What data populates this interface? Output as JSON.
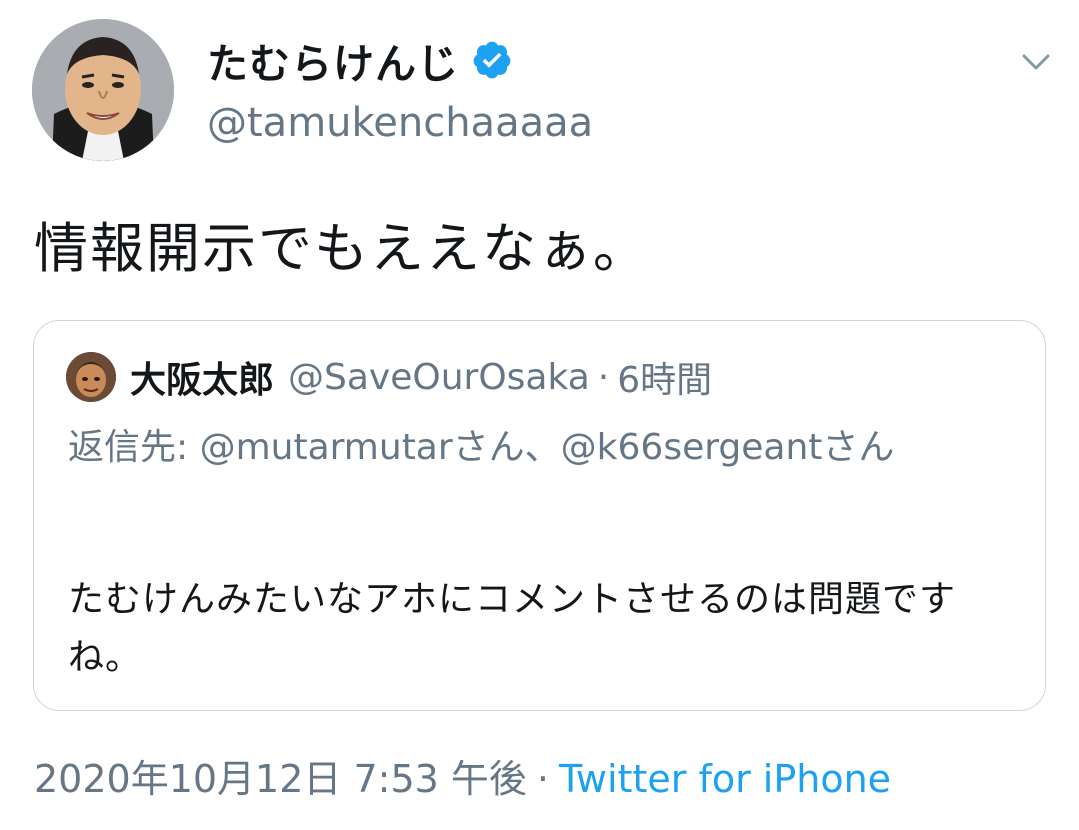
{
  "author": {
    "display_name": "たむらけんじ",
    "handle": "@tamukenchaaaaa",
    "verified": true,
    "verified_icon": "verified-badge-icon",
    "verified_color": "#1da1f2"
  },
  "tweet": {
    "text": "情報開示でもええなぁ。"
  },
  "quote": {
    "display_name": "大阪太郎",
    "handle": "@SaveOurOsaka",
    "separator": "·",
    "time": "6時間",
    "reply_prefix": "返信先: ",
    "reply_mention_1": "@mutarmutarさん、",
    "reply_mention_2": "@k66sergeantさん",
    "text": "たむけんみたいなアホにコメントさせるのは問題ですね。"
  },
  "meta": {
    "timestamp": "2020年10月12日 7:53 午後",
    "separator": "·",
    "source": "Twitter for iPhone"
  },
  "icons": {
    "menu": "chevron-down-icon"
  },
  "colors": {
    "text_primary": "#14171a",
    "text_secondary": "#657786",
    "link": "#1da1f2",
    "border": "#ccd6dd"
  }
}
